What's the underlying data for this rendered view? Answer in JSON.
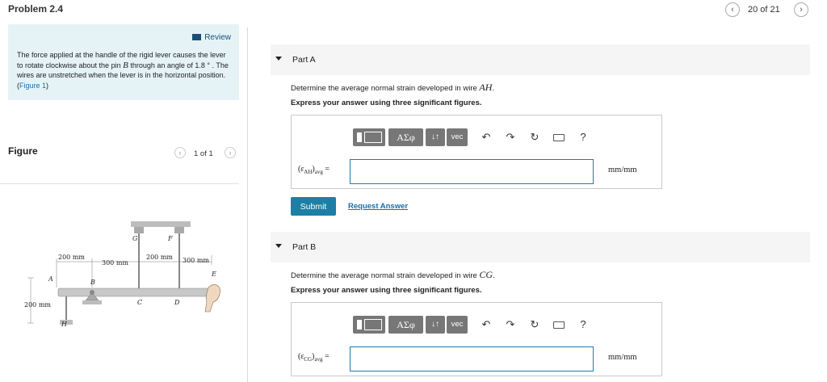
{
  "header": {
    "title": "Problem 2.4",
    "page_count": "20 of 21",
    "prev_icon": "chevron-left-icon",
    "next_icon": "chevron-right-icon"
  },
  "statement": {
    "review_label": "Review",
    "text_before_pin": "The force applied at the handle of the rigid lever causes the lever to rotate clockwise about the pin ",
    "pin": "B",
    "text_before_angle": " through an angle of ",
    "angle": "1.8",
    "text_after_angle": " °  . The wires are unstretched when the lever is in the horizontal position. (",
    "figure_link": "Figure 1",
    "text_end": ")"
  },
  "figure": {
    "label": "Figure",
    "count": "1 of 1",
    "labels": {
      "G": "G",
      "F": "F",
      "A": "A",
      "B": "B",
      "C": "C",
      "D": "D",
      "E": "E",
      "H": "H"
    },
    "dims": {
      "ab": "200 mm",
      "bc": "300 mm",
      "cd": "200 mm",
      "de": "300 mm",
      "ah": "200 mm"
    }
  },
  "toolbar": {
    "greek": "ΑΣφ",
    "sort": "↓↑",
    "vec": "vec",
    "help": "?"
  },
  "part_a": {
    "title": "Part A",
    "question_pre": "Determine the average normal strain developed in wire ",
    "wire": "AH",
    "question_post": ".",
    "instruction": "Express your answer using three significant figures.",
    "var_sym": "ε",
    "var_sub": "AH",
    "var_avg": "avg",
    "equals": "=",
    "answer_value": "",
    "unit": "mm/mm",
    "submit": "Submit",
    "request": "Request Answer"
  },
  "part_b": {
    "title": "Part B",
    "question_pre": "Determine the average normal strain developed in wire ",
    "wire": "CG",
    "question_post": ".",
    "instruction": "Express your answer using three significant figures.",
    "var_sym": "ε",
    "var_sub": "CG",
    "var_avg": "avg",
    "equals": "=",
    "answer_value": "",
    "unit": "mm/mm"
  }
}
